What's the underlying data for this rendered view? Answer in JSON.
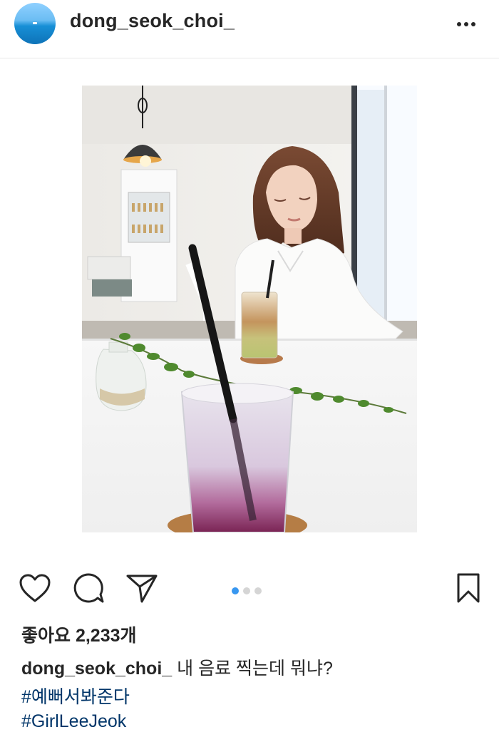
{
  "post": {
    "username": "dong_seok_choi_",
    "likes_label": "좋아요 2,233개",
    "caption_user": "dong_seok_choi_",
    "caption_text": " 내 음료 찍는데 뭐냐?",
    "hashtags": [
      "#예뻐서봐준다",
      "#GirlLeeJeok"
    ],
    "carousel": {
      "count": 3,
      "active_index": 0
    }
  },
  "icons": {
    "more": "more-options-icon",
    "like": "heart-icon",
    "comment": "comment-icon",
    "share": "send-icon",
    "save": "bookmark-icon"
  },
  "colors": {
    "text": "#262626",
    "hashtag": "#003569",
    "carousel_active": "#3897f0",
    "carousel_inactive": "#d5d5d5"
  }
}
